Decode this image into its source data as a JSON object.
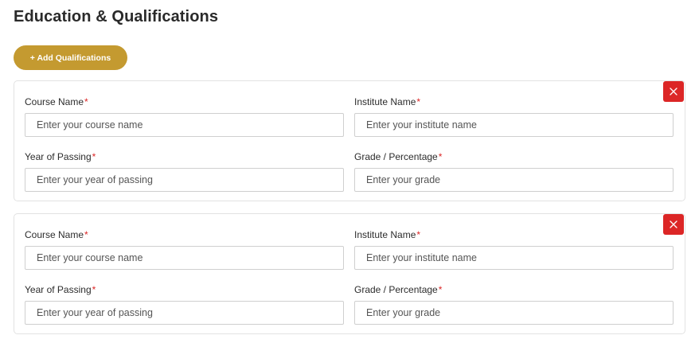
{
  "page": {
    "title": "Education & Qualifications",
    "add_button_label": "+ Add Qualifications"
  },
  "colors": {
    "accent": "#c49a30",
    "danger": "#dc2626",
    "required": "#dc2626"
  },
  "icons": {
    "remove": "close-icon"
  },
  "qualifications": [
    {
      "fields": {
        "course": {
          "label": "Course Name",
          "required_mark": "*",
          "placeholder": "Enter your course name",
          "value": ""
        },
        "institute": {
          "label": "Institute Name",
          "required_mark": "*",
          "placeholder": "Enter your institute name",
          "value": ""
        },
        "year": {
          "label": "Year of Passing",
          "required_mark": "*",
          "placeholder": "Enter your year of passing",
          "value": ""
        },
        "grade": {
          "label": "Grade / Percentage",
          "required_mark": "*",
          "placeholder": "Enter your grade",
          "value": ""
        }
      }
    },
    {
      "fields": {
        "course": {
          "label": "Course Name",
          "required_mark": "*",
          "placeholder": "Enter your course name",
          "value": ""
        },
        "institute": {
          "label": "Institute Name",
          "required_mark": "*",
          "placeholder": "Enter your institute name",
          "value": ""
        },
        "year": {
          "label": "Year of Passing",
          "required_mark": "*",
          "placeholder": "Enter your year of passing",
          "value": ""
        },
        "grade": {
          "label": "Grade / Percentage",
          "required_mark": "*",
          "placeholder": "Enter your grade",
          "value": ""
        }
      }
    }
  ]
}
